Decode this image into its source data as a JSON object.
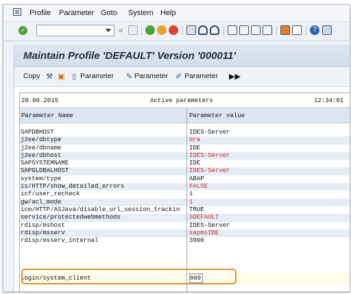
{
  "menu": {
    "items": [
      "Profile",
      "Parameter",
      "Goto",
      "System",
      "Help"
    ]
  },
  "toolbar": {
    "command_field_value": "",
    "icons": [
      "enter-icon",
      "back-icon",
      "exit-icon",
      "cancel-icon",
      "print-icon",
      "find-icon",
      "help-icon",
      "layout-icon"
    ]
  },
  "screen": {
    "title": "Maintain Profile 'DEFAULT' Version '000011'"
  },
  "app_toolbar": {
    "copy": "Copy",
    "param1": "Parameter",
    "param2": "Parameter",
    "param3": "Parameter"
  },
  "grid": {
    "date": "20.06.2015",
    "heading": "Active parameters",
    "time": "12:34:01",
    "col_name": "Parameter Name",
    "col_value": "Parameter value",
    "rows": [
      {
        "name": "SAPDBHOST",
        "value": "IDES-Server",
        "red": false
      },
      {
        "name": "j2ee/dbtype",
        "value": "ora",
        "red": true
      },
      {
        "name": "j2ee/dbname",
        "value": "IDE",
        "red": false
      },
      {
        "name": "j2ee/dbhost",
        "value": "IDES-Server",
        "red": true
      },
      {
        "name": "SAPSYSTEMNAME",
        "value": "IDE",
        "red": false
      },
      {
        "name": "SAPGLOBALHOST",
        "value": "IDES-Server",
        "red": true
      },
      {
        "name": "system/type",
        "value": "ABAP",
        "red": false
      },
      {
        "name": "is/HTTP/show_detailed_errors",
        "value": "FALSE",
        "red": true
      },
      {
        "name": "icf/user_recheck",
        "value": "1",
        "red": false
      },
      {
        "name": "gw/acl_mode",
        "value": "1",
        "red": true
      },
      {
        "name": "icm/HTTP/ASJava/disable_url_session_trackin",
        "value": "TRUE",
        "red": false
      },
      {
        "name": "service/protectedwebmethods",
        "value": "SDEFAULT",
        "red": true
      },
      {
        "name": "rdisp/mshost",
        "value": "IDES-Server",
        "red": false
      },
      {
        "name": "rdisp/msserv",
        "value": "sapmsIDE",
        "red": true
      },
      {
        "name": "rdisp/msserv_internal",
        "value": "3900",
        "red": false
      }
    ],
    "highlighted_row": {
      "name": "login/system_client",
      "value": "800"
    }
  },
  "colors": {
    "highlight": "#e38f2c",
    "changed_value": "#cc1f1f",
    "header_bg": "#dbe6f2"
  }
}
